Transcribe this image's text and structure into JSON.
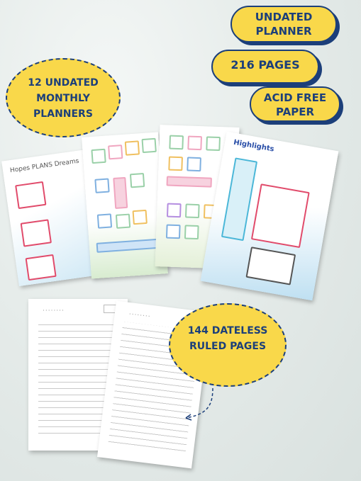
{
  "bubbles": {
    "undated_planner": "UNDATED PLANNER",
    "pages_216": "216 PAGES",
    "acid_free": "ACID FREE PAPER",
    "monthly": "12 UNDATED MONTHLY PLANNERS",
    "ruled": "144 DATELESS RULED PAGES"
  },
  "pages": {
    "hopes_title": "Hopes PLANS Dreams",
    "highlights_title": "Highlights",
    "spiral": "········"
  },
  "colors": {
    "bubble_fill": "#f9d84a",
    "bubble_text": "#1c3f7a"
  }
}
